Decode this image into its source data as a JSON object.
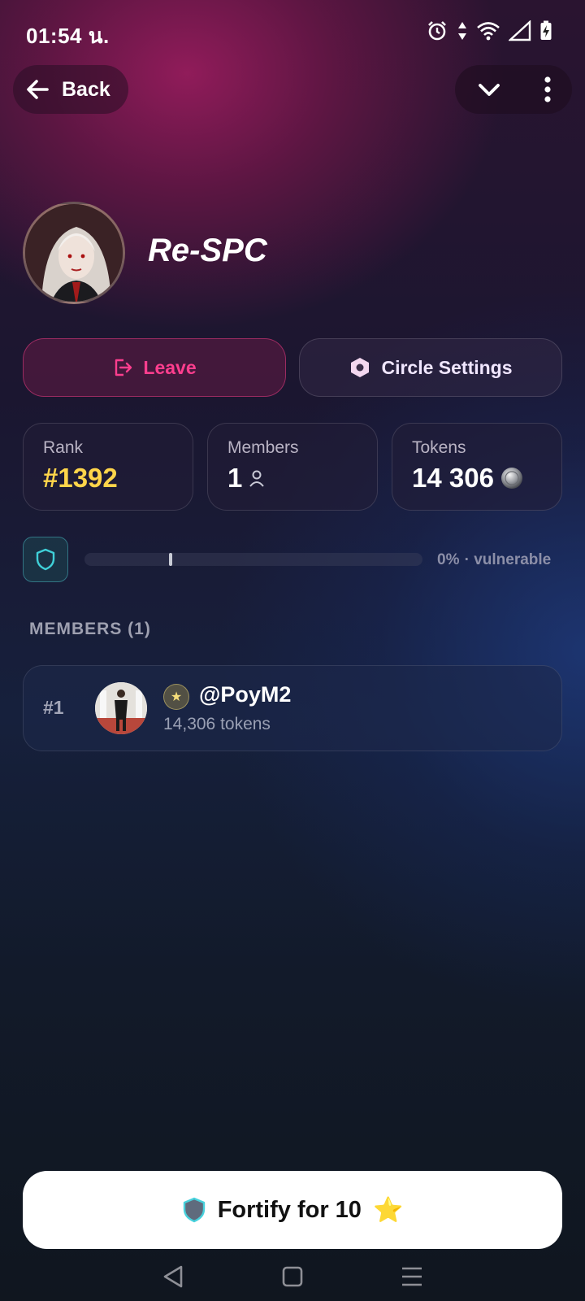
{
  "status_bar": {
    "time": "01:54 น.",
    "icons": [
      "alarm-icon",
      "data-arrows-icon",
      "wifi-icon",
      "signal-icon",
      "battery-charging-icon"
    ]
  },
  "header": {
    "back_label": "Back",
    "back_icon": "arrow-left-icon",
    "collapse_icon": "chevron-down-icon",
    "menu_icon": "more-vertical-icon"
  },
  "circle": {
    "name": "Re-SPC"
  },
  "actions": {
    "leave_label": "Leave",
    "leave_icon": "logout-icon",
    "settings_label": "Circle Settings",
    "settings_icon": "hexagon-gear-icon"
  },
  "stats": {
    "rank_label": "Rank",
    "rank_value": "#1392",
    "members_label": "Members",
    "members_value": "1",
    "tokens_label": "Tokens",
    "tokens_value": "14 306"
  },
  "defense": {
    "percent": "0%",
    "status": "· vulnerable",
    "progress_fraction": 0.0
  },
  "members_section": {
    "title": "MEMBERS (1)",
    "members": [
      {
        "rank": "#1",
        "name": "@PoyM2",
        "tokens": "14,306 tokens",
        "badge": "★"
      }
    ]
  },
  "fortify": {
    "label": "Fortify for 10",
    "star": "⭐"
  },
  "colors": {
    "accent_pink": "#ff3e8e",
    "rank_gold": "#ffd54a",
    "shield_teal": "#3fd0d8"
  }
}
